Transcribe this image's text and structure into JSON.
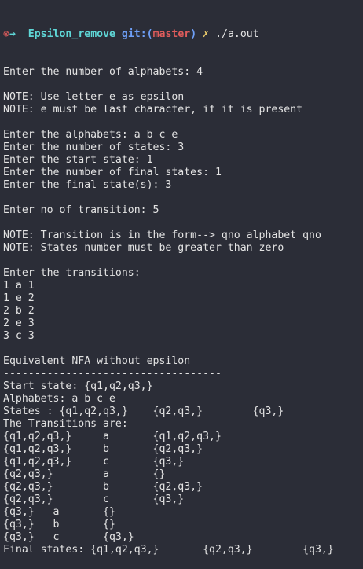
{
  "prompt": {
    "status_glyph": "⊗",
    "arrow_glyph": "→",
    "directory": "Epsilon_remove",
    "git_prefix": "git:(",
    "branch": "master",
    "git_suffix": ")",
    "dirty_glyph": "✗",
    "command": "./a.out"
  },
  "output_lines": [
    "Enter the number of alphabets: 4",
    "",
    "NOTE: Use letter e as epsilon",
    "NOTE: e must be last character, if it is present",
    "",
    "Enter the alphabets: a b c e",
    "Enter the number of states: 3",
    "Enter the start state: 1",
    "Enter the number of final states: 1",
    "Enter the final state(s): 3",
    "",
    "Enter no of transition: 5",
    "",
    "NOTE: Transition is in the form--> qno alphabet qno",
    "NOTE: States number must be greater than zero",
    "",
    "Enter the transitions:",
    "1 a 1",
    "1 e 2",
    "2 b 2",
    "2 e 3",
    "3 c 3",
    "",
    "Equivalent NFA without epsilon",
    "-----------------------------------",
    "Start state: {q1,q2,q3,}",
    "Alphabets: a b c e",
    "States : {q1,q2,q3,}    {q2,q3,}        {q3,}",
    "The Transitions are:",
    "{q1,q2,q3,}     a       {q1,q2,q3,}",
    "{q1,q2,q3,}     b       {q2,q3,}",
    "{q1,q2,q3,}     c       {q3,}",
    "{q2,q3,}        a       {}",
    "{q2,q3,}        b       {q2,q3,}",
    "{q2,q3,}        c       {q3,}",
    "{q3,}   a       {}",
    "{q3,}   b       {}",
    "{q3,}   c       {q3,}",
    "Final states: {q1,q2,q3,}       {q2,q3,}        {q3,}"
  ],
  "colors": {
    "background": "#2b2d37",
    "text": "#e3e3e3",
    "status_red": "#e05c5c",
    "directory_cyan": "#5fd7d7",
    "git_blue": "#6e9ff7",
    "dirty_yellow": "#e8c96a"
  }
}
